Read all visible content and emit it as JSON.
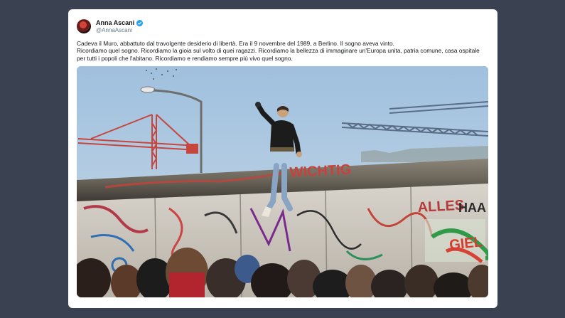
{
  "tweet": {
    "author_name": "Anna Ascani",
    "author_handle": "@AnnaAscani",
    "verified": true,
    "lines": [
      "Cadeva il Muro, abbattuto dal travolgente desiderio di libertà. Era il 9 novembre del 1989, a Berlino. Il sogno aveva vinto.",
      "Ricordiamo quel sogno. Ricordiamo la gioia sul volto di quei ragazzi. Ricordiamo la bellezza di immaginare un'Europa unita, patria comune, casa ospitale",
      "per tutti i popoli che l'abitano. Ricordiamo e rendiamo sempre più vivo quel sogno."
    ]
  },
  "photo": {
    "graffiti_texts": [
      "WICHTIG",
      "ALLES",
      "HAA",
      "GIEL"
    ]
  },
  "colors": {
    "background": "#3a4150",
    "card": "#ffffff",
    "verified_badge": "#1da1f2",
    "handle_text": "#657786"
  }
}
